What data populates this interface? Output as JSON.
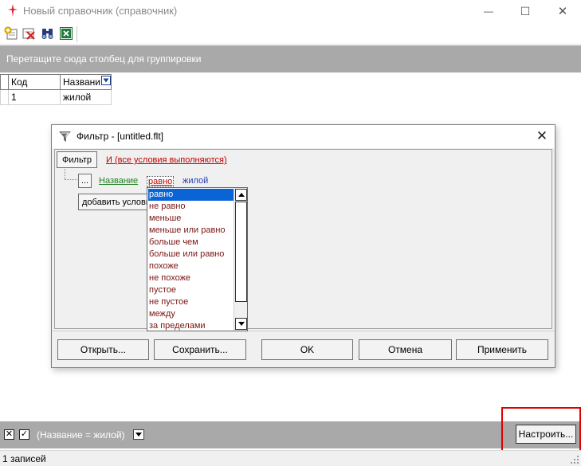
{
  "window": {
    "title": "Новый справочник  (справочник)",
    "controls": {
      "minimize": "—",
      "maximize": "☐",
      "close": "✕"
    }
  },
  "toolbar": {
    "icons": [
      "add-record-icon",
      "delete-record-icon",
      "find-icon",
      "excel-export-icon"
    ]
  },
  "group_panel": {
    "hint": "Перетащите сюда столбец для группировки"
  },
  "grid": {
    "columns": [
      "Код",
      "Названи"
    ],
    "rows": [
      [
        "1",
        "жилой"
      ]
    ]
  },
  "filter_dialog": {
    "title": "Фильтр - [untitled.flt]",
    "root_button": "Фильтр",
    "root_condition": "И (все условия выполняются)",
    "condition_menu_button": "...",
    "field": "Название",
    "operator": "равно",
    "value": "жилой",
    "add_condition": "добавить условие",
    "operators": [
      "равно",
      "не равно",
      "меньше",
      "меньше или равно",
      "больше чем",
      "больше или равно",
      "похоже",
      "не похоже",
      "пустое",
      "не пустое",
      "между",
      "за пределами"
    ],
    "selected_operator": "равно",
    "buttons": {
      "open": "Открыть...",
      "save": "Сохранить...",
      "ok": "OK",
      "cancel": "Отмена",
      "apply": "Применить"
    }
  },
  "filter_bar": {
    "close_glyph": "✕",
    "check_glyph": "✓",
    "expression": "(Название = жилой)",
    "setup_button": "Настроить..."
  },
  "status": {
    "records": "1 записей"
  },
  "colors": {
    "panel_gray": "#a9a9a9",
    "selection_blue": "#0a64d6",
    "link_red": "#c00000",
    "link_green": "#238023",
    "link_blue": "#1f3fb0",
    "highlight_frame": "#e00000"
  }
}
